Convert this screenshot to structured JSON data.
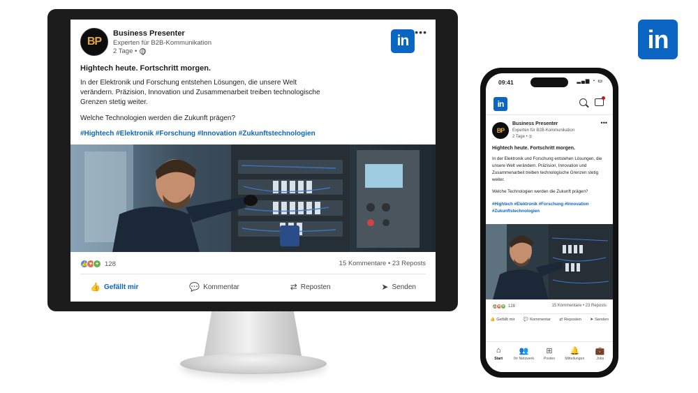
{
  "brand": {
    "logo_text": "in",
    "accent": "#0a66c2"
  },
  "post": {
    "author": "Business Presenter",
    "avatar_text": "BP",
    "headline": "Experten für B2B-Kommunikation",
    "age": "2 Tage •",
    "title": "Hightech heute. Fortschritt morgen.",
    "body_desktop": "In der Elektronik und Forschung entstehen Lösungen, die unsere Welt verändern. Präzision, Innovation und Zusammenarbeit treiben technologische Grenzen stetig weiter.",
    "question": "Welche Technologien werden die Zukunft prägen?",
    "hashtags": "#Hightech #Elektronik #Forschung #Innovation #Zukunftstechnologien",
    "reaction_count": "128",
    "comments_reposts": "15 Kommentare • 23 Reposts",
    "more": "•••"
  },
  "actions": [
    {
      "label": "Gefällt mir",
      "icon": "thumbs-up-icon"
    },
    {
      "label": "Kommentar",
      "icon": "comment-icon"
    },
    {
      "label": "Reposten",
      "icon": "repost-icon"
    },
    {
      "label": "Senden",
      "icon": "send-icon"
    }
  ],
  "phone": {
    "time": "09:41",
    "signal": "▂▄▆ ◔ ▭",
    "body": "In der Elektronik und Forschung entstehen Lösungen, die unsere Welt verändern. Präzision, Innovation und Zusammenarbeit treiben technologische Grenzen stetig weiter.",
    "age": "2 Tage • ◎",
    "nav": [
      {
        "label": "Start",
        "icon": "home-icon"
      },
      {
        "label": "Ihr Netzwerk",
        "icon": "network-icon"
      },
      {
        "label": "Posten",
        "icon": "post-icon"
      },
      {
        "label": "Mitteilungen",
        "icon": "bell-icon"
      },
      {
        "label": "Jobs",
        "icon": "jobs-icon"
      }
    ]
  }
}
